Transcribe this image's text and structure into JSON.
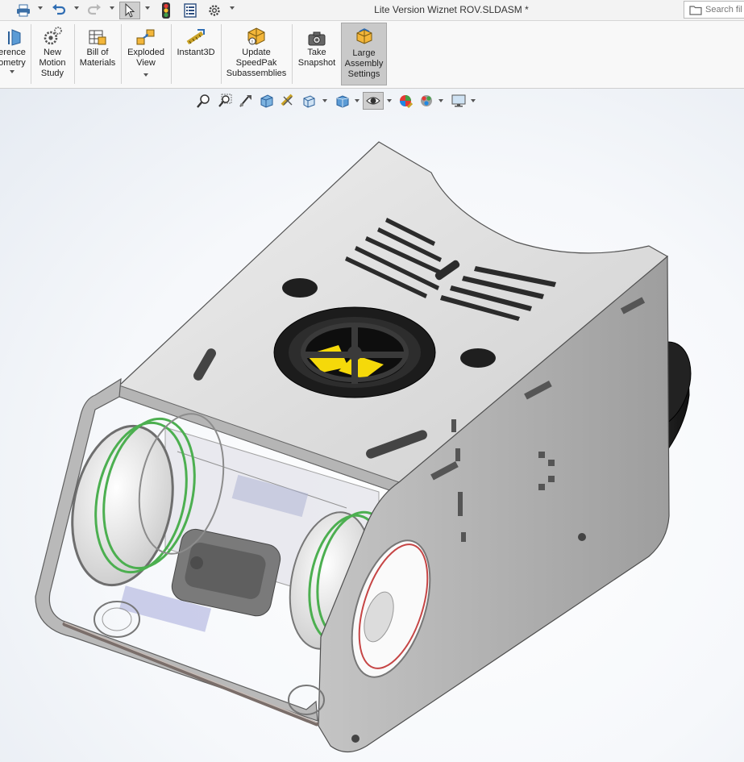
{
  "window": {
    "title": "Lite Version Wiznet ROV.SLDASM *",
    "search_placeholder": "Search fil"
  },
  "quick_access": [
    "print-icon",
    "undo-icon",
    "redo-icon",
    "select-icon",
    "rebuild-icon",
    "file-properties-icon",
    "options-icon"
  ],
  "ribbon": {
    "buttons": [
      {
        "id": "reference-geometry",
        "label": "erence\nometry",
        "icon": "reference-geometry-icon",
        "has_dropdown": true
      },
      {
        "id": "new-motion-study",
        "label": "New\nMotion\nStudy",
        "icon": "motion-study-icon",
        "has_dropdown": false
      },
      {
        "id": "bill-of-materials",
        "label": "Bill of\nMaterials",
        "icon": "bill-of-materials-icon",
        "has_dropdown": false
      },
      {
        "id": "exploded-view",
        "label": "Exploded\nView",
        "icon": "exploded-view-icon",
        "has_dropdown": true
      },
      {
        "id": "instant3d",
        "label": "Instant3D",
        "icon": "instant3d-icon",
        "has_dropdown": false
      },
      {
        "id": "update-speedpak",
        "label": "Update\nSpeedPak\nSubassemblies",
        "icon": "speedpak-icon",
        "has_dropdown": false
      },
      {
        "id": "take-snapshot",
        "label": "Take\nSnapshot",
        "icon": "camera-icon",
        "has_dropdown": false
      },
      {
        "id": "large-assembly-settings",
        "label": "Large\nAssembly\nSettings",
        "icon": "large-assembly-icon",
        "has_dropdown": false,
        "active": true
      }
    ]
  },
  "view_toolbar": [
    "zoom-to-fit-icon",
    "zoom-to-area-icon",
    "previous-view-icon",
    "section-view-icon",
    "dynamic-annotation-icon",
    "view-orientation-icon",
    "display-style-icon",
    "hide-show-items-icon",
    "edit-appearance-icon",
    "apply-scene-icon",
    "view-settings-icon"
  ],
  "colors": {
    "ribbon_bg": "#f8f8f8",
    "active_button": "#c9c9c9",
    "plate": "#d9d9d9",
    "thruster": "#1a1a1a",
    "hatch": "#f5d90a",
    "copper": "#c8652a"
  }
}
